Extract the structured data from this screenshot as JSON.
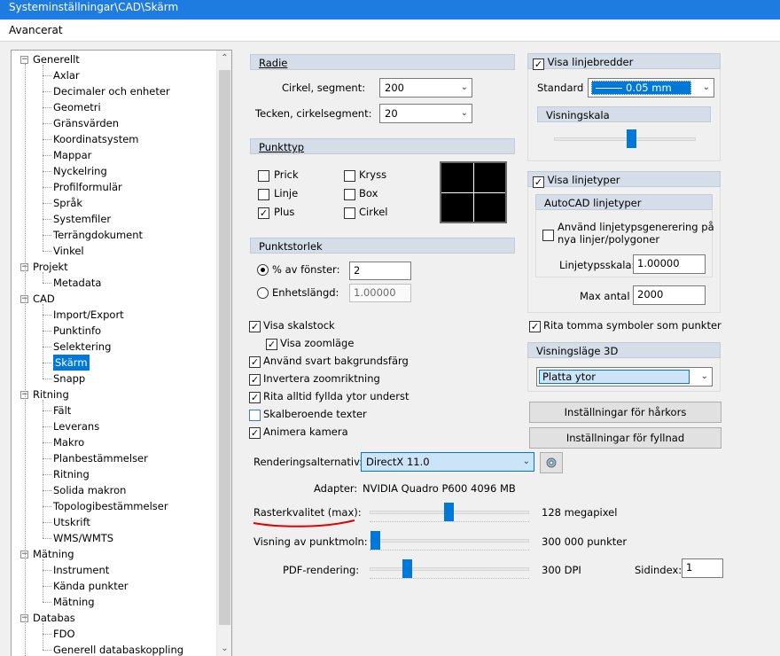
{
  "window": {
    "title": "Systeminställningar\\CAD\\Skärm"
  },
  "menu": {
    "item": "Avancerat"
  },
  "tree": {
    "items": [
      {
        "label": "Generellt",
        "level": 0,
        "expanded": true
      },
      {
        "label": "Axlar",
        "level": 1
      },
      {
        "label": "Decimaler och enheter",
        "level": 1
      },
      {
        "label": "Geometri",
        "level": 1
      },
      {
        "label": "Gränsvärden",
        "level": 1
      },
      {
        "label": "Koordinatsystem",
        "level": 1
      },
      {
        "label": "Mappar",
        "level": 1
      },
      {
        "label": "Nyckelring",
        "level": 1
      },
      {
        "label": "Profilformulär",
        "level": 1
      },
      {
        "label": "Språk",
        "level": 1
      },
      {
        "label": "Systemfiler",
        "level": 1
      },
      {
        "label": "Terrängdokument",
        "level": 1
      },
      {
        "label": "Vinkel",
        "level": 1
      },
      {
        "label": "Projekt",
        "level": 0,
        "expanded": true
      },
      {
        "label": "Metadata",
        "level": 1
      },
      {
        "label": "CAD",
        "level": 0,
        "expanded": true
      },
      {
        "label": "Import/Export",
        "level": 1
      },
      {
        "label": "Punktinfo",
        "level": 1
      },
      {
        "label": "Selektering",
        "level": 1
      },
      {
        "label": "Skärm",
        "level": 1,
        "selected": true
      },
      {
        "label": "Snapp",
        "level": 1
      },
      {
        "label": "Ritning",
        "level": 0,
        "expanded": true
      },
      {
        "label": "Fält",
        "level": 1
      },
      {
        "label": "Leverans",
        "level": 1
      },
      {
        "label": "Makro",
        "level": 1
      },
      {
        "label": "Planbestämmelser",
        "level": 1
      },
      {
        "label": "Ritning",
        "level": 1
      },
      {
        "label": "Solida makron",
        "level": 1
      },
      {
        "label": "Topologibestämmelser",
        "level": 1
      },
      {
        "label": "Utskrift",
        "level": 1
      },
      {
        "label": "WMS/WMTS",
        "level": 1
      },
      {
        "label": "Mätning",
        "level": 0,
        "expanded": true
      },
      {
        "label": "Instrument",
        "level": 1
      },
      {
        "label": "Kända punkter",
        "level": 1
      },
      {
        "label": "Mätning",
        "level": 1
      },
      {
        "label": "Databas",
        "level": 0,
        "expanded": true
      },
      {
        "label": "FDO",
        "level": 1
      },
      {
        "label": "Generell databaskoppling",
        "level": 1
      }
    ]
  },
  "radie": {
    "header": "Radie",
    "circle_label": "Cirkel, segment:",
    "circle_value": "200",
    "char_label": "Tecken, cirkelsegment:",
    "char_value": "20"
  },
  "punkttyp": {
    "header": "Punkttyp",
    "options": {
      "prick": {
        "label": "Prick",
        "checked": false
      },
      "kryss": {
        "label": "Kryss",
        "checked": false
      },
      "linje": {
        "label": "Linje",
        "checked": false
      },
      "box": {
        "label": "Box",
        "checked": false
      },
      "plus": {
        "label": "Plus",
        "checked": true
      },
      "cirkel": {
        "label": "Cirkel",
        "checked": false
      }
    }
  },
  "punktstorlek": {
    "header": "Punktstorlek",
    "pct_label": "% av fönster:",
    "pct_value": "2",
    "unit_label": "Enhetslängd:",
    "unit_value": "1.00000",
    "selected": "pct"
  },
  "checks": {
    "visa_skalstock": "Visa skalstock",
    "visa_zoomlage": "Visa zoomläge",
    "svart_bakgrund": "Använd svart bakgrundsfärg",
    "invertera_zoom": "Invertera zoomriktning",
    "fyllda_ytor": "Rita alltid fyllda ytor underst",
    "skalberoende": "Skalberoende texter",
    "animera_kamera": "Animera kamera",
    "check_mark": "✓"
  },
  "rendering": {
    "label": "Renderingsalternativ:",
    "value": "DirectX 11.0",
    "adapter_label": "Adapter:",
    "adapter_value": "NVIDIA Quadro P600 4096 MB"
  },
  "sliders": {
    "raster_label": "Rasterkvalitet (max):",
    "raster_value": "128 megapixel",
    "punktmoln_label": "Visning av punktmoln:",
    "punktmoln_value": "300 000 punkter",
    "pdf_label": "PDF-rendering:",
    "pdf_value": "300 DPI",
    "sidindex_label": "Sidindex:",
    "sidindex_value": "1"
  },
  "linjebredder": {
    "header": "Visa linjebredder",
    "standard_label": "Standard",
    "standard_value": "0.05 mm",
    "scale_header": "Visningskala"
  },
  "linjetyper": {
    "header": "Visa linjetyper",
    "sub_header": "AutoCAD linjetyper",
    "generation_line1": "Använd linjetypsgenerering på",
    "generation_line2": "nya linjer/polygoner",
    "scale_label": "Linjetypsskala:",
    "scale_value": "1.00000",
    "max_label": "Max antal",
    "max_value": "2000"
  },
  "right_misc": {
    "empty_symbols": "Rita tomma symboler som punkter",
    "view3d_header": "Visningsläge 3D",
    "view3d_value": "Platta ytor",
    "btn_crosshair": "Inställningar för hårkors",
    "btn_fill": "Inställningar för fyllnad"
  },
  "colors": {
    "accent": "#0078d7",
    "group_header": "#d5dde8",
    "annotation": "#e00000"
  }
}
